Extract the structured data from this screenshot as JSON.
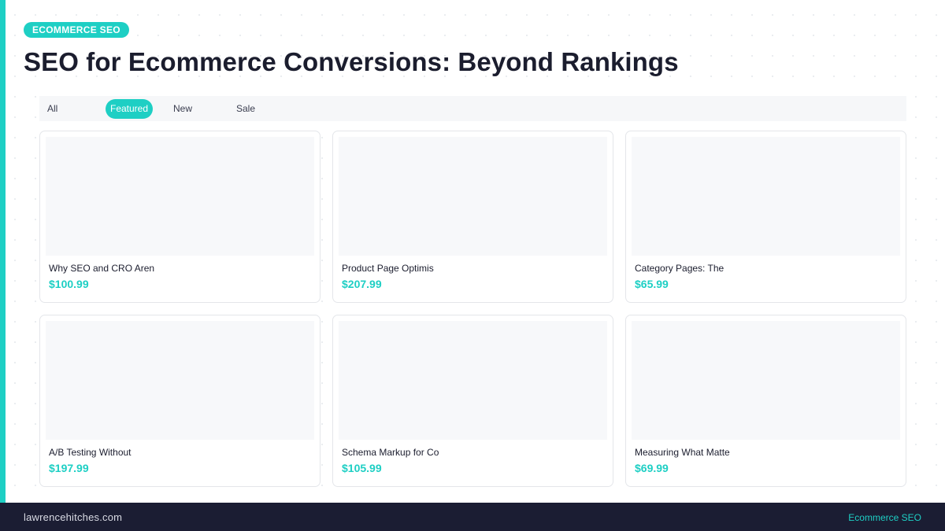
{
  "header": {
    "category": "Ecommerce SEO",
    "title": "SEO for Ecommerce Conversions: Beyond Rankings"
  },
  "filters": {
    "tabs": [
      {
        "label": "All",
        "active": false
      },
      {
        "label": "Featured",
        "active": true
      },
      {
        "label": "New",
        "active": false
      },
      {
        "label": "Sale",
        "active": false
      }
    ]
  },
  "products": [
    {
      "title": "Why SEO and CRO Aren",
      "price": "$100.99"
    },
    {
      "title": "Product Page Optimis",
      "price": "$207.99"
    },
    {
      "title": "Category Pages: The",
      "price": "$65.99"
    },
    {
      "title": "A/B Testing Without",
      "price": "$197.99"
    },
    {
      "title": "Schema Markup for Co",
      "price": "$105.99"
    },
    {
      "title": "Measuring What Matte",
      "price": "$69.99"
    }
  ],
  "footer": {
    "site": "lawrencehitches.com",
    "category": "Ecommerce SEO"
  },
  "colors": {
    "accent": "#1ecfc4",
    "dark": "#1b1d33",
    "text": "#1b1d2e"
  }
}
